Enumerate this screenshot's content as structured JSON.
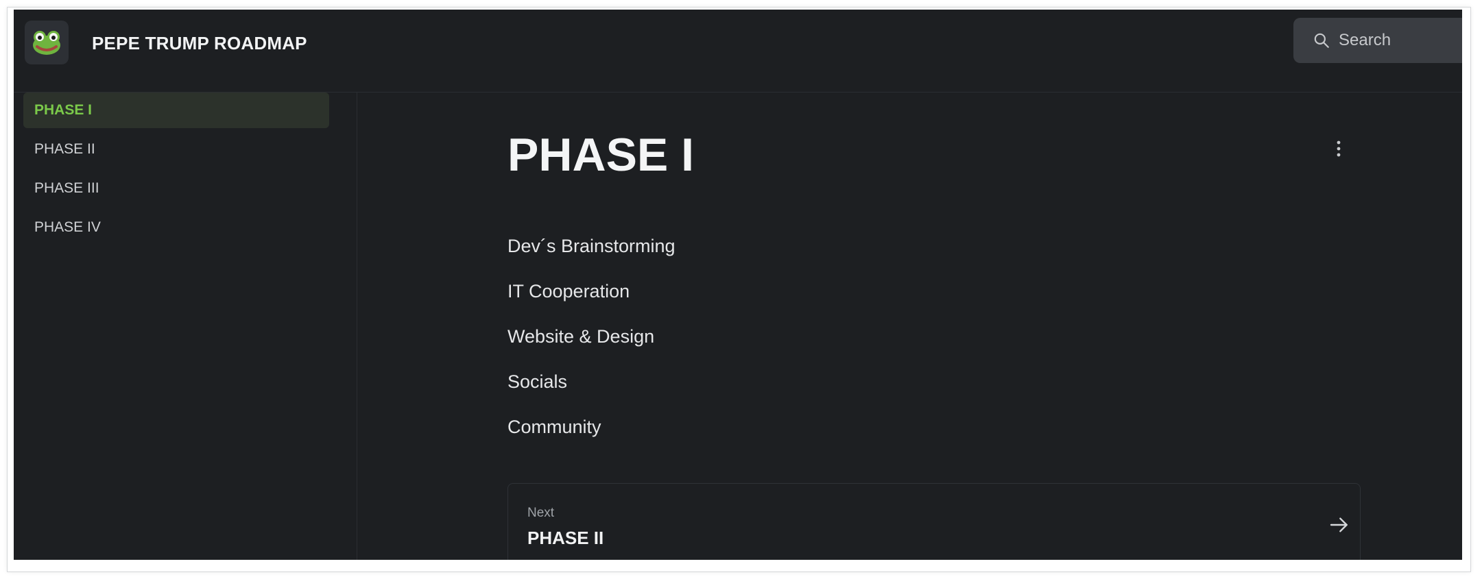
{
  "header": {
    "title": "PEPE TRUMP ROADMAP",
    "logo_icon": "frog-face-icon",
    "search": {
      "placeholder": "Search",
      "icon": "search-icon"
    }
  },
  "sidebar": {
    "items": [
      {
        "label": "PHASE I",
        "active": true
      },
      {
        "label": "PHASE II",
        "active": false
      },
      {
        "label": "PHASE III",
        "active": false
      },
      {
        "label": "PHASE IV",
        "active": false
      }
    ]
  },
  "main": {
    "title": "PHASE I",
    "menu_icon": "more-vertical-icon",
    "items": [
      "Dev´s Brainstorming",
      "IT Cooperation",
      "Website & Design",
      "Socials",
      "Community"
    ],
    "next": {
      "label": "Next",
      "title": "PHASE II",
      "icon": "arrow-right-icon"
    }
  },
  "colors": {
    "background": "#1d1f22",
    "accent": "#7bc94a",
    "active_bg": "#2c322b",
    "search_bg": "#3a3d42"
  }
}
